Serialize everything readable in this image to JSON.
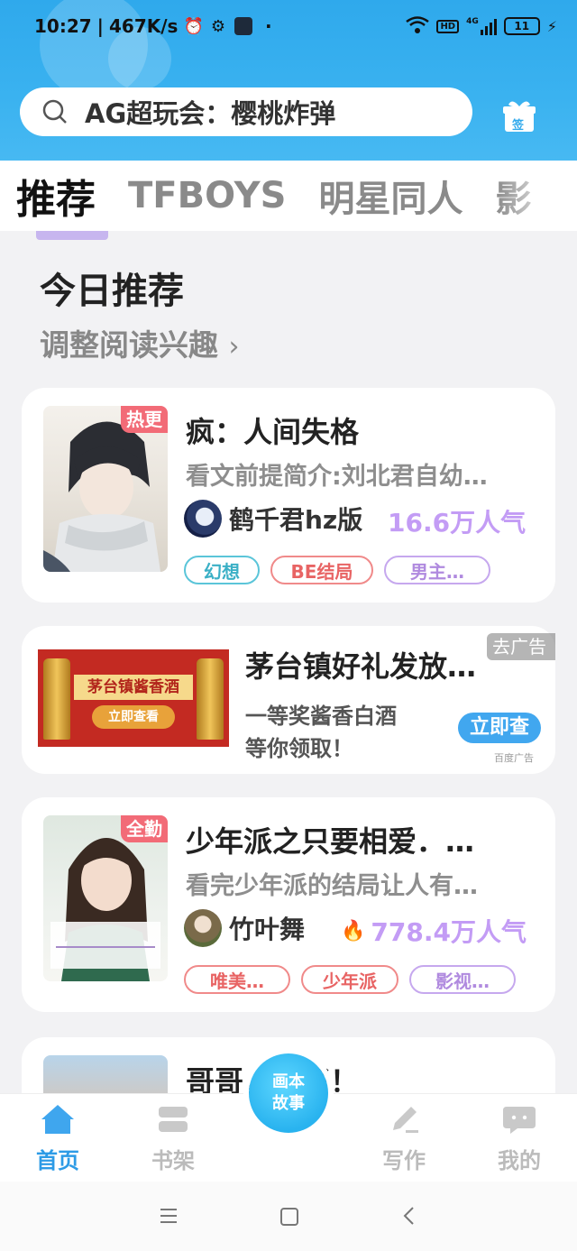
{
  "status": {
    "time": "10:27",
    "speed": "467K/s",
    "network": "4G",
    "hd": "HD",
    "battery": "11"
  },
  "search": {
    "text": "AG超玩会：樱桃炸弹",
    "gift_label": "签"
  },
  "tabs": [
    "推荐",
    "TFBOYS",
    "明星同人",
    "影"
  ],
  "section": {
    "title": "今日推荐",
    "subtitle": "调整阅读兴趣"
  },
  "books": [
    {
      "badge": "热更",
      "title": "疯：人间失格",
      "desc": "看文前提简介:刘北君自幼…",
      "author": "鹤千君hz版",
      "popularity": "16.6万人气",
      "tags": [
        "幻想",
        "BE结局",
        "男主…"
      ]
    },
    {
      "badge": "全勤",
      "title": "少年派之只要相爱．…",
      "desc": "看完少年派的结局让人有…",
      "author": "竹叶舞",
      "popularity": "778.4万人气",
      "tags": [
        "唯美…",
        "少年派",
        "影视…"
      ]
    },
    {
      "title": "哥哥，你好！"
    }
  ],
  "ad": {
    "title": "茅台镇好礼发放…",
    "tag": "去广告",
    "desc1": "一等奖酱香白酒",
    "desc2": "等你领取！",
    "button": "立即查",
    "source": "百度广告",
    "banner_text": "茅台镇酱香酒",
    "banner_button": "立即查看"
  },
  "nav": {
    "home": "首页",
    "shelf": "书架",
    "center": [
      "画本",
      "故事"
    ],
    "write": "写作",
    "me": "我的"
  },
  "colors": {
    "accent": "#2d9be6",
    "header": "#3ab2f0",
    "popularity": "#c39cf5"
  }
}
